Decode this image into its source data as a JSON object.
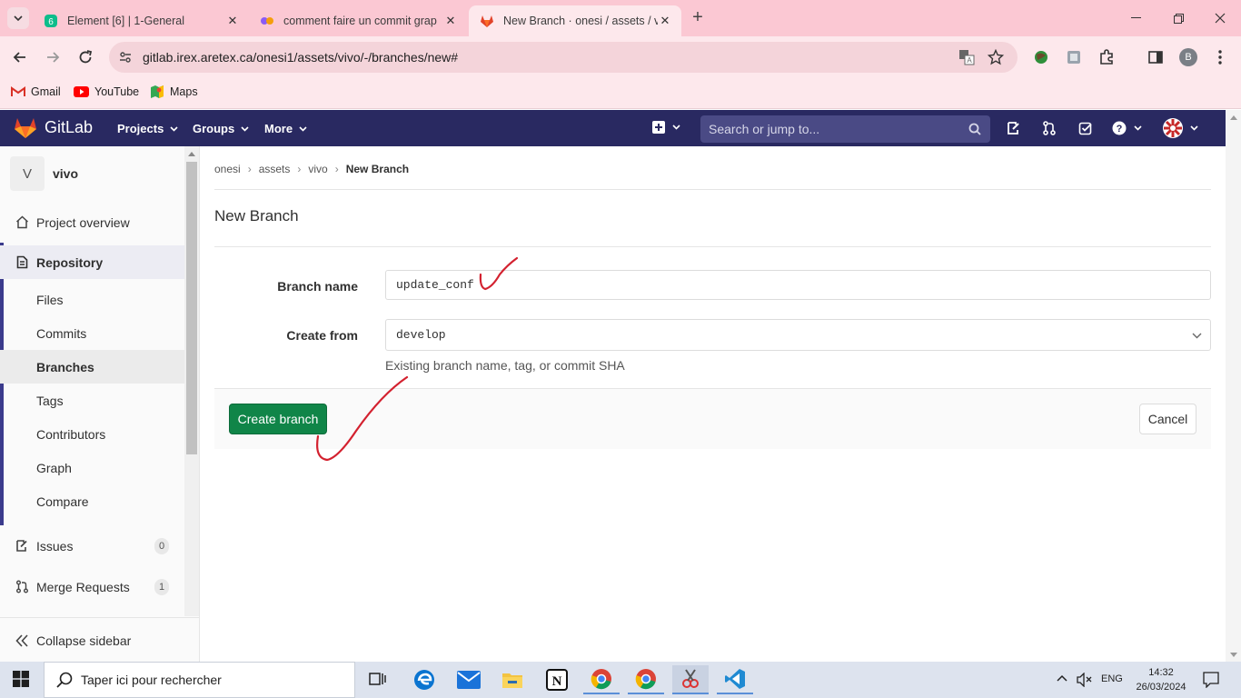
{
  "browser": {
    "tabs": [
      {
        "title": "Element [6] | 1-General",
        "active": false
      },
      {
        "title": "comment faire un commit grap",
        "active": false
      },
      {
        "title": "New Branch · onesi / assets / vi",
        "active": true
      }
    ],
    "url": "gitlab.irex.aretex.ca/onesi1/assets/vivo/-/branches/new#",
    "bookmarks": [
      "Gmail",
      "YouTube",
      "Maps"
    ],
    "profile_initial": "B"
  },
  "gitlab": {
    "brand": "GitLab",
    "nav": [
      "Projects",
      "Groups",
      "More"
    ],
    "search_placeholder": "Search or jump to..."
  },
  "sidebar": {
    "project_initial": "V",
    "project_name": "vivo",
    "overview": "Project overview",
    "repository": "Repository",
    "repo_items": [
      "Files",
      "Commits",
      "Branches",
      "Tags",
      "Contributors",
      "Graph",
      "Compare"
    ],
    "active_item": "Branches",
    "issues": "Issues",
    "issues_count": "0",
    "merge_requests": "Merge Requests",
    "mr_count": "1",
    "collapse": "Collapse sidebar"
  },
  "breadcrumb": [
    "onesi",
    "assets",
    "vivo",
    "New Branch"
  ],
  "page": {
    "title": "New Branch",
    "branch_name_label": "Branch name",
    "branch_name_value": "update_conf",
    "create_from_label": "Create from",
    "create_from_value": "develop",
    "help_text": "Existing branch name, tag, or commit SHA",
    "create_button": "Create branch",
    "cancel_button": "Cancel"
  },
  "taskbar": {
    "search_placeholder": "Taper ici pour rechercher",
    "language": "ENG",
    "time": "14:32",
    "date": "26/03/2024"
  },
  "colors": {
    "gitlab_header": "#292961",
    "create_button": "#108548",
    "tab_strip": "#fbc8d3",
    "annotation": "#d3212f"
  }
}
